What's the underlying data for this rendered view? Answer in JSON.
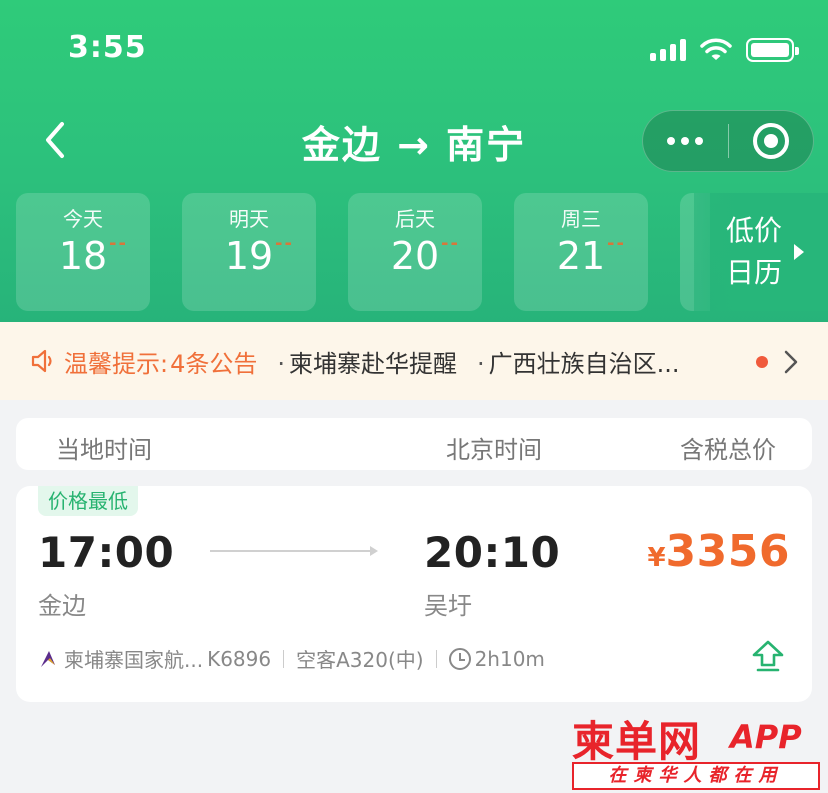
{
  "status_bar": {
    "time": "3:55"
  },
  "nav": {
    "title": "金边 → 南宁"
  },
  "dates": [
    {
      "day": "今天",
      "num": "18",
      "price": "--"
    },
    {
      "day": "明天",
      "num": "19",
      "price": "--"
    },
    {
      "day": "后天",
      "num": "20",
      "price": "--"
    },
    {
      "day": "周三",
      "num": "21",
      "price": "--"
    }
  ],
  "low_price_calendar": {
    "line1": "低价",
    "line2": "日历"
  },
  "notice": {
    "label": "温馨提示:",
    "count": "4条公告",
    "items": [
      "柬埔寨赴华提醒",
      "广西壮族自治区..."
    ]
  },
  "columns": {
    "local_time": "当地时间",
    "beijing_time": "北京时间",
    "total_price": "含税总价"
  },
  "flight": {
    "badge": "价格最低",
    "dep_time": "17:00",
    "dep_city": "金边",
    "arr_time": "20:10",
    "arr_city": "吴圩",
    "currency": "¥",
    "price": "3356",
    "airline": "柬埔寨国家航...",
    "flight_no": "K6896",
    "aircraft": "空客A320(中)",
    "duration": "2h10m"
  },
  "watermark": {
    "main": "柬单网",
    "app": "APP",
    "slogan": "在柬华人都在用"
  },
  "colors": {
    "brand_green": "#2cc07c",
    "price_orange": "#f06a2d",
    "notice_orange": "#f0703a"
  },
  "icons": [
    "back-icon",
    "more-icon",
    "close-mini-program-icon",
    "speaker-icon",
    "chevron-right-icon",
    "airline-logo-icon",
    "clock-icon",
    "share-icon"
  ]
}
